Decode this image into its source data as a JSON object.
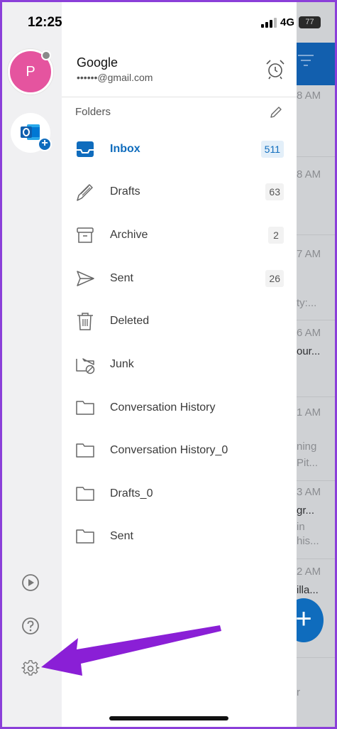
{
  "status_bar": {
    "time": "12:25",
    "network": "4G",
    "battery": "77"
  },
  "account": {
    "avatar_initial": "P",
    "name": "Google",
    "email": "••••••@gmail.com"
  },
  "folders_header": "Folders",
  "folders": [
    {
      "name": "Inbox",
      "count": "511",
      "icon": "inbox-icon",
      "active": true
    },
    {
      "name": "Drafts",
      "count": "63",
      "icon": "pencil-icon"
    },
    {
      "name": "Archive",
      "count": "2",
      "icon": "archive-box-icon"
    },
    {
      "name": "Sent",
      "count": "26",
      "icon": "paper-plane-icon"
    },
    {
      "name": "Deleted",
      "count": "",
      "icon": "trash-icon"
    },
    {
      "name": "Junk",
      "count": "",
      "icon": "junk-folder-icon"
    },
    {
      "name": "Conversation History",
      "count": "",
      "icon": "folder-icon"
    },
    {
      "name": "Conversation History_0",
      "count": "",
      "icon": "folder-icon"
    },
    {
      "name": "Drafts_0",
      "count": "",
      "icon": "folder-icon"
    },
    {
      "name": "Sent",
      "count": "",
      "icon": "folder-icon"
    }
  ],
  "background_list": {
    "times": [
      "8 AM",
      "8 AM",
      "7 AM",
      "6 AM",
      "1 AM",
      "3 AM",
      "2 AM"
    ],
    "snippets": [
      "ty:...",
      "our...",
      "ning",
      "Pit...",
      "gr...",
      "in",
      "his...",
      "illa...",
      "r"
    ]
  },
  "colors": {
    "accent": "#0f6cbd",
    "avatar": "#e5549f",
    "annotation_arrow": "#8a1fd6"
  }
}
